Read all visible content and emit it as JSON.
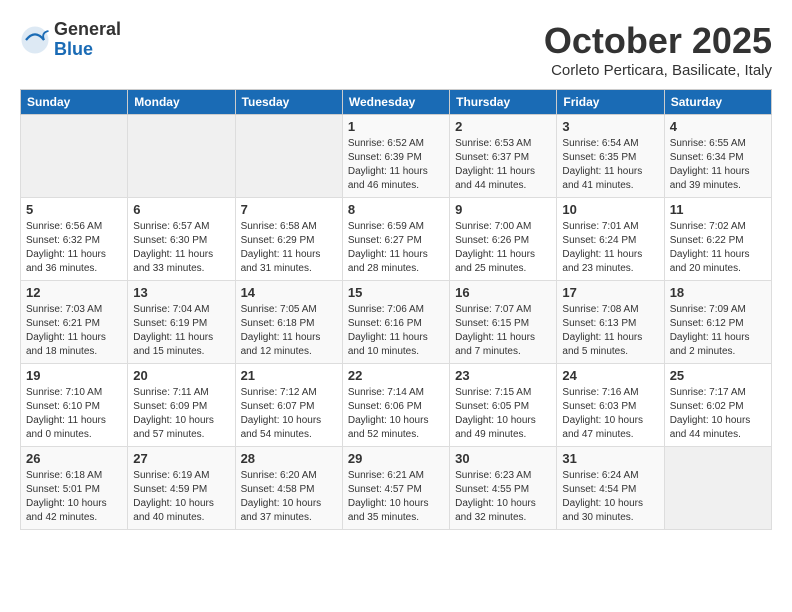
{
  "header": {
    "logo_general": "General",
    "logo_blue": "Blue",
    "month_title": "October 2025",
    "location": "Corleto Perticara, Basilicate, Italy"
  },
  "days_of_week": [
    "Sunday",
    "Monday",
    "Tuesday",
    "Wednesday",
    "Thursday",
    "Friday",
    "Saturday"
  ],
  "weeks": [
    [
      {
        "day": "",
        "info": ""
      },
      {
        "day": "",
        "info": ""
      },
      {
        "day": "",
        "info": ""
      },
      {
        "day": "1",
        "info": "Sunrise: 6:52 AM\nSunset: 6:39 PM\nDaylight: 11 hours\nand 46 minutes."
      },
      {
        "day": "2",
        "info": "Sunrise: 6:53 AM\nSunset: 6:37 PM\nDaylight: 11 hours\nand 44 minutes."
      },
      {
        "day": "3",
        "info": "Sunrise: 6:54 AM\nSunset: 6:35 PM\nDaylight: 11 hours\nand 41 minutes."
      },
      {
        "day": "4",
        "info": "Sunrise: 6:55 AM\nSunset: 6:34 PM\nDaylight: 11 hours\nand 39 minutes."
      }
    ],
    [
      {
        "day": "5",
        "info": "Sunrise: 6:56 AM\nSunset: 6:32 PM\nDaylight: 11 hours\nand 36 minutes."
      },
      {
        "day": "6",
        "info": "Sunrise: 6:57 AM\nSunset: 6:30 PM\nDaylight: 11 hours\nand 33 minutes."
      },
      {
        "day": "7",
        "info": "Sunrise: 6:58 AM\nSunset: 6:29 PM\nDaylight: 11 hours\nand 31 minutes."
      },
      {
        "day": "8",
        "info": "Sunrise: 6:59 AM\nSunset: 6:27 PM\nDaylight: 11 hours\nand 28 minutes."
      },
      {
        "day": "9",
        "info": "Sunrise: 7:00 AM\nSunset: 6:26 PM\nDaylight: 11 hours\nand 25 minutes."
      },
      {
        "day": "10",
        "info": "Sunrise: 7:01 AM\nSunset: 6:24 PM\nDaylight: 11 hours\nand 23 minutes."
      },
      {
        "day": "11",
        "info": "Sunrise: 7:02 AM\nSunset: 6:22 PM\nDaylight: 11 hours\nand 20 minutes."
      }
    ],
    [
      {
        "day": "12",
        "info": "Sunrise: 7:03 AM\nSunset: 6:21 PM\nDaylight: 11 hours\nand 18 minutes."
      },
      {
        "day": "13",
        "info": "Sunrise: 7:04 AM\nSunset: 6:19 PM\nDaylight: 11 hours\nand 15 minutes."
      },
      {
        "day": "14",
        "info": "Sunrise: 7:05 AM\nSunset: 6:18 PM\nDaylight: 11 hours\nand 12 minutes."
      },
      {
        "day": "15",
        "info": "Sunrise: 7:06 AM\nSunset: 6:16 PM\nDaylight: 11 hours\nand 10 minutes."
      },
      {
        "day": "16",
        "info": "Sunrise: 7:07 AM\nSunset: 6:15 PM\nDaylight: 11 hours\nand 7 minutes."
      },
      {
        "day": "17",
        "info": "Sunrise: 7:08 AM\nSunset: 6:13 PM\nDaylight: 11 hours\nand 5 minutes."
      },
      {
        "day": "18",
        "info": "Sunrise: 7:09 AM\nSunset: 6:12 PM\nDaylight: 11 hours\nand 2 minutes."
      }
    ],
    [
      {
        "day": "19",
        "info": "Sunrise: 7:10 AM\nSunset: 6:10 PM\nDaylight: 11 hours\nand 0 minutes."
      },
      {
        "day": "20",
        "info": "Sunrise: 7:11 AM\nSunset: 6:09 PM\nDaylight: 10 hours\nand 57 minutes."
      },
      {
        "day": "21",
        "info": "Sunrise: 7:12 AM\nSunset: 6:07 PM\nDaylight: 10 hours\nand 54 minutes."
      },
      {
        "day": "22",
        "info": "Sunrise: 7:14 AM\nSunset: 6:06 PM\nDaylight: 10 hours\nand 52 minutes."
      },
      {
        "day": "23",
        "info": "Sunrise: 7:15 AM\nSunset: 6:05 PM\nDaylight: 10 hours\nand 49 minutes."
      },
      {
        "day": "24",
        "info": "Sunrise: 7:16 AM\nSunset: 6:03 PM\nDaylight: 10 hours\nand 47 minutes."
      },
      {
        "day": "25",
        "info": "Sunrise: 7:17 AM\nSunset: 6:02 PM\nDaylight: 10 hours\nand 44 minutes."
      }
    ],
    [
      {
        "day": "26",
        "info": "Sunrise: 6:18 AM\nSunset: 5:01 PM\nDaylight: 10 hours\nand 42 minutes."
      },
      {
        "day": "27",
        "info": "Sunrise: 6:19 AM\nSunset: 4:59 PM\nDaylight: 10 hours\nand 40 minutes."
      },
      {
        "day": "28",
        "info": "Sunrise: 6:20 AM\nSunset: 4:58 PM\nDaylight: 10 hours\nand 37 minutes."
      },
      {
        "day": "29",
        "info": "Sunrise: 6:21 AM\nSunset: 4:57 PM\nDaylight: 10 hours\nand 35 minutes."
      },
      {
        "day": "30",
        "info": "Sunrise: 6:23 AM\nSunset: 4:55 PM\nDaylight: 10 hours\nand 32 minutes."
      },
      {
        "day": "31",
        "info": "Sunrise: 6:24 AM\nSunset: 4:54 PM\nDaylight: 10 hours\nand 30 minutes."
      },
      {
        "day": "",
        "info": ""
      }
    ]
  ]
}
